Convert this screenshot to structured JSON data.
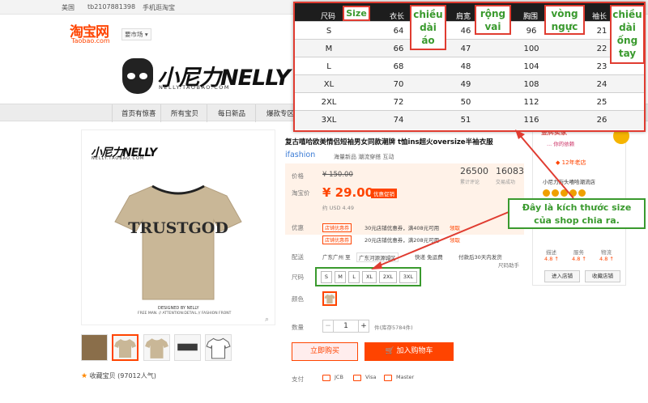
{
  "topbar": {
    "country": "美国",
    "user": "tb2107881398",
    "mobile": "手机逛淘宝"
  },
  "header": {
    "tb_logo_cn": "淘宝网",
    "tb_logo_en": "Taobao.com",
    "region_select": "要市场",
    "shop_logo": "小尼力NELLY",
    "shop_logo_sub": "NELLY.TAOBAO.COM"
  },
  "nav": {
    "items": [
      "首页有惊喜",
      "所有宝贝",
      "每日新品",
      "爆款专区"
    ]
  },
  "gallery": {
    "logo": "小尼力NELLY",
    "logo_sub": "NELLY.TAOBAO.COM",
    "shirt_print": "TRUSTGOD",
    "caption1": "DESIGNED BY NELLY",
    "caption2": "FREE MAN. // ATTENTION:DETAIL // FASHION FRONT",
    "favorite": "收藏宝贝 (97012人气)"
  },
  "product": {
    "title": "复古嘻哈欧美情侣短袖男女同款潮牌 t恤ins超火oversize半袖衣服",
    "ifashion": "ifashion",
    "ifashion_text": "海量新品 潮流穿搭 互动",
    "price_label": "价格",
    "price_old": "¥ 150.00",
    "taobao_label": "淘宝价",
    "price_new": "¥ 29.00",
    "price_badge": "优惠促销",
    "usd": "约 USD 4.49",
    "reviews_num": "26500",
    "reviews_label": "累计评论",
    "sales_num": "16083",
    "sales_label": "交易成功",
    "promo_label": "优惠",
    "promos": [
      {
        "tag": "店铺优惠券",
        "text": "30元店铺优惠券，满408元可用",
        "link": "领取"
      },
      {
        "tag": "店铺优惠券",
        "text": "20元店铺优惠券，满208元可用",
        "link": "领取"
      }
    ],
    "ship_label": "配送",
    "ship_from": "广东广州 至",
    "ship_to": "广东河源源城区",
    "ship_express": "快递 免运费",
    "ship_promise": "付款后30天内发货",
    "size_help": "尺码助手",
    "size_label": "尺码",
    "sizes": [
      "S",
      "M",
      "L",
      "XL",
      "2XL",
      "3XL"
    ],
    "color_label": "颜色",
    "qty_label": "数量",
    "qty_minus": "−",
    "qty_value": "1",
    "qty_plus": "+",
    "stock": "件(库存5784件)",
    "buy_now": "立即购买",
    "add_cart": "加入购物车",
    "pay_label": "支付",
    "pay_methods": [
      "JCB",
      "Visa",
      "Master"
    ]
  },
  "shop": {
    "gold_seller": "金牌卖家",
    "gold_sub": "... 你的依赖",
    "years": "12年老店",
    "name": "小尼力街头嘻哈潮流店",
    "dsr_labels": [
      "描述",
      "服务",
      "物流"
    ],
    "dsr_values": [
      "4.8 ↑",
      "4.8 ↑",
      "4.8 ↑"
    ],
    "btn_enter": "进入店铺",
    "btn_fav": "收藏店铺"
  },
  "size_chart": {
    "headers": [
      "尺码",
      "衣长",
      "肩宽",
      "胸围",
      "袖长"
    ],
    "rows": [
      [
        "S",
        "64",
        "46",
        "96",
        "21"
      ],
      [
        "M",
        "66",
        "47",
        "100",
        "22"
      ],
      [
        "L",
        "68",
        "48",
        "104",
        "23"
      ],
      [
        "XL",
        "70",
        "49",
        "108",
        "24"
      ],
      [
        "2XL",
        "72",
        "50",
        "112",
        "25"
      ],
      [
        "3XL",
        "74",
        "51",
        "116",
        "26"
      ]
    ],
    "annotations": {
      "size": "Size",
      "length": "chiều dài áo",
      "shoulder": "rộng vai",
      "chest": "vòng ngực",
      "sleeve": "chiều dài ống tay"
    }
  },
  "note": {
    "line1": "Đây là kích thước size",
    "line2": "của shop chia ra."
  },
  "colors": {
    "accent": "#ff4400",
    "annotation_red": "#e03c31",
    "annotation_green": "#3a9a2e"
  }
}
